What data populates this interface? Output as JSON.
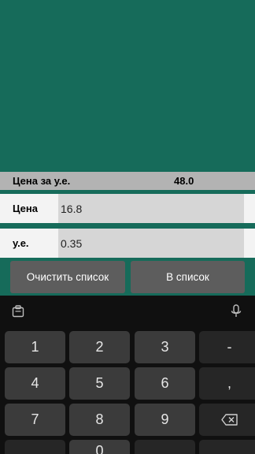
{
  "summary": {
    "price_per_unit_label": "Цена за у.е.",
    "price_per_unit_value": "48.0"
  },
  "form": {
    "price_label": "Цена",
    "price_value": "16.8",
    "units_label": "у.е.",
    "units_value": "0.35"
  },
  "actions": {
    "clear_label": "Очистить список",
    "add_label": "В список"
  },
  "keyboard": {
    "toolbar_icons": [
      "clipboard-icon",
      "microphone-icon"
    ],
    "keys": [
      "1",
      "2",
      "3",
      "-",
      "4",
      "5",
      "6",
      ",",
      "7",
      "8",
      "9",
      "backspace",
      "",
      "0",
      ""
    ],
    "minus": "-",
    "comma": ","
  },
  "colors": {
    "background": "#166b5a",
    "summary_bar": "#b3b3b3",
    "button": "#5d5d5d",
    "keyboard": "#101010",
    "key": "#3b3b3b"
  }
}
